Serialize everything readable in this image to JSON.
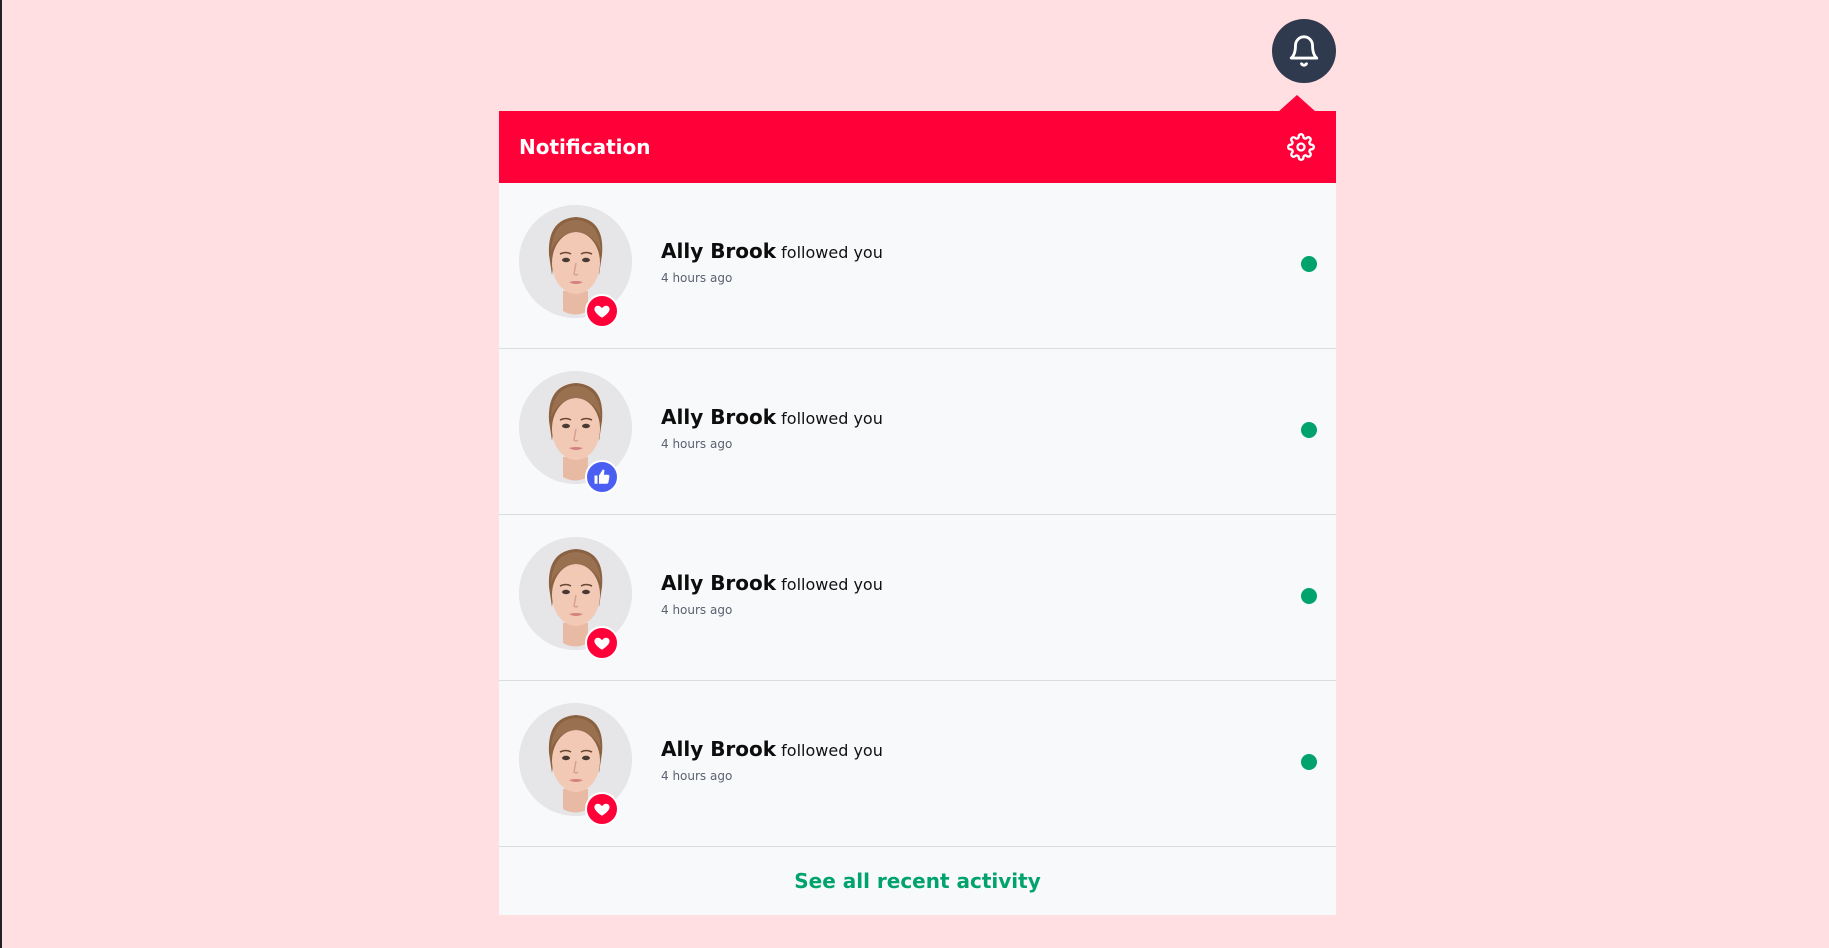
{
  "header": {
    "title": "Notification",
    "accent_color": "#ff0038"
  },
  "bell": {
    "icon": "bell-icon",
    "bg_color": "#2f3a4f"
  },
  "settings": {
    "icon": "gear-icon"
  },
  "notifications": [
    {
      "name": "Ally Brook",
      "action": "followed you",
      "time": "4 hours ago",
      "reaction": "heart",
      "unread": true
    },
    {
      "name": "Ally Brook",
      "action": "followed you",
      "time": "4 hours ago",
      "reaction": "thumbs-up",
      "unread": true
    },
    {
      "name": "Ally Brook",
      "action": "followed you",
      "time": "4 hours ago",
      "reaction": "heart",
      "unread": true
    },
    {
      "name": "Ally Brook",
      "action": "followed you",
      "time": "4 hours ago",
      "reaction": "heart",
      "unread": true
    }
  ],
  "footer": {
    "see_all_label": "See all recent activity",
    "link_color": "#00a36b"
  },
  "colors": {
    "page_bg": "#ffdfe1",
    "heart_badge": "#ff0038",
    "like_badge": "#4b5ef2",
    "unread_dot": "#00a36b"
  }
}
